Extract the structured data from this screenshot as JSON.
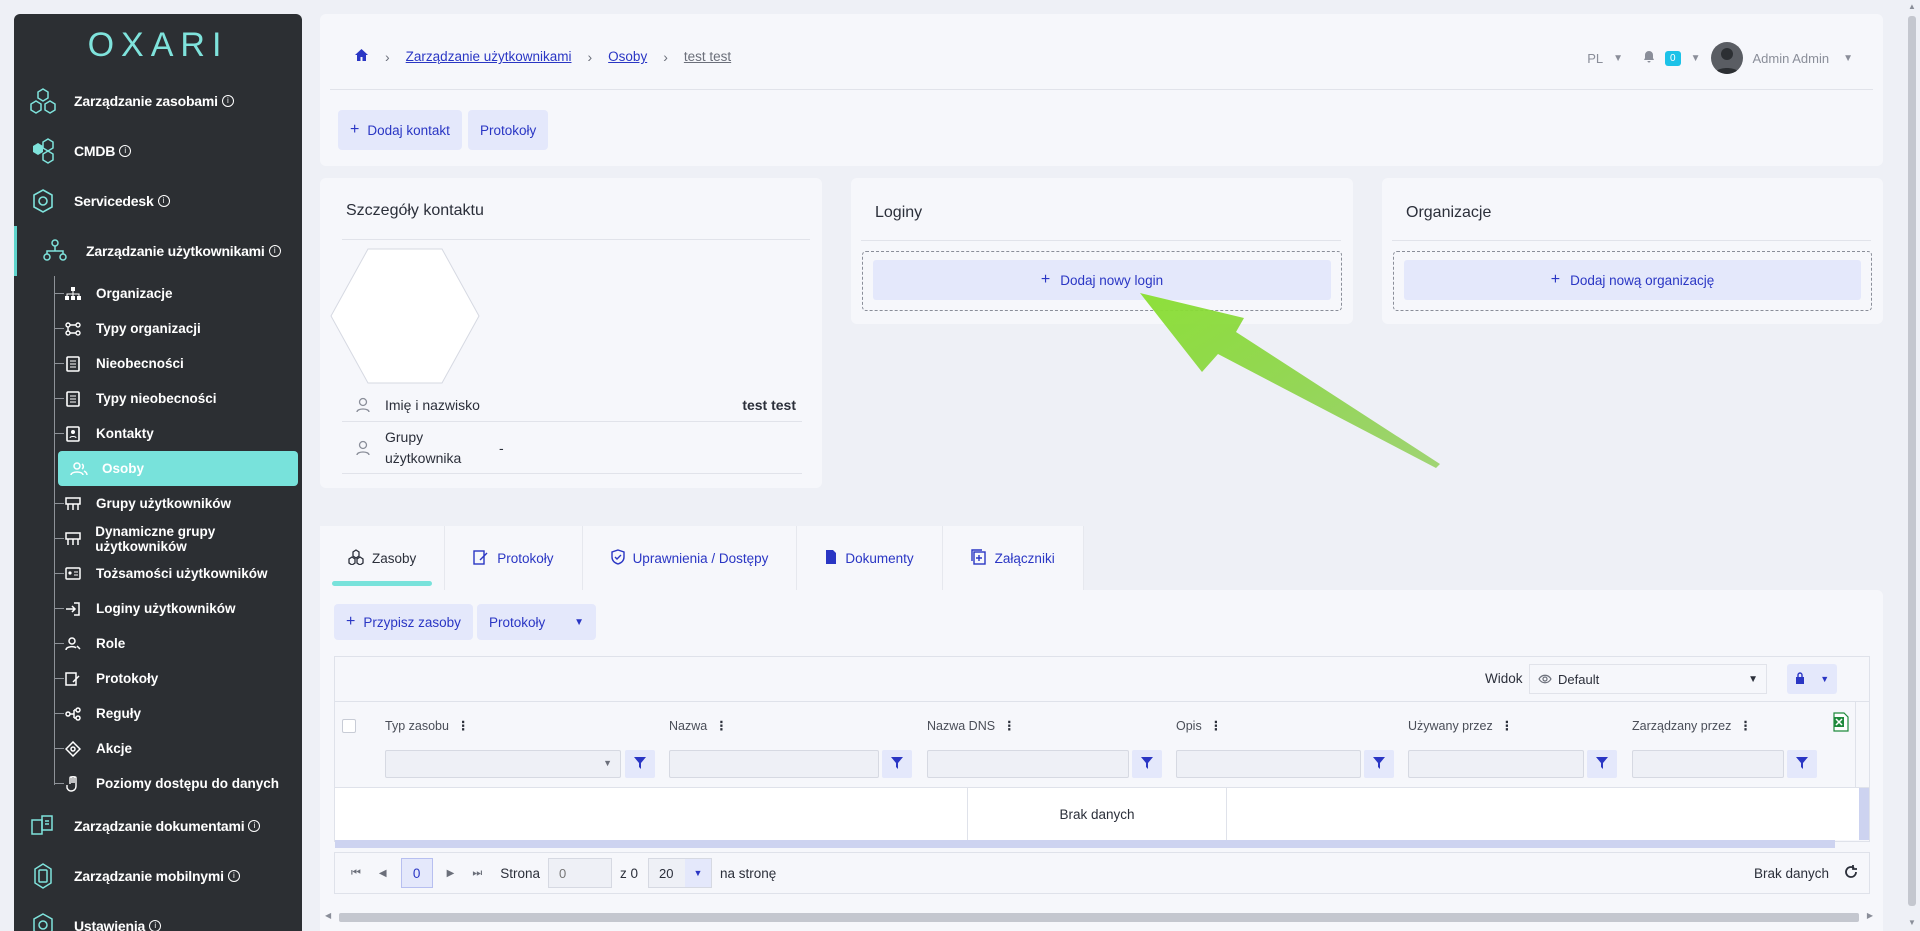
{
  "sidebar": {
    "logo": "OXARI",
    "main_items": [
      {
        "label": "Zarządzanie zasobami"
      },
      {
        "label": "CMDB"
      },
      {
        "label": "Servicedesk"
      },
      {
        "label": "Zarządzanie użytkownikami"
      }
    ],
    "sub_items": [
      {
        "label": "Organizacje"
      },
      {
        "label": "Typy organizacji"
      },
      {
        "label": "Nieobecności"
      },
      {
        "label": "Typy nieobecności"
      },
      {
        "label": "Kontakty"
      },
      {
        "label": "Osoby"
      },
      {
        "label": "Grupy użytkowników"
      },
      {
        "label": "Dynamiczne grupy użytkowników"
      },
      {
        "label": "Tożsamości użytkowników"
      },
      {
        "label": "Loginy użytkowników"
      },
      {
        "label": "Role"
      },
      {
        "label": "Protokoły"
      },
      {
        "label": "Reguły"
      },
      {
        "label": "Akcje"
      },
      {
        "label": "Poziomy dostępu do danych"
      }
    ],
    "bottom_items": [
      {
        "label": "Zarządzanie dokumentami"
      },
      {
        "label": "Zarządzanie mobilnymi"
      },
      {
        "label": "Ustawienia"
      }
    ],
    "accent_color": "#78e2db"
  },
  "header": {
    "breadcrumb": [
      "Zarządzanie użytkownikami",
      "Osoby",
      "test test"
    ],
    "language": "PL",
    "notifications": "0",
    "user": "Admin Admin",
    "buttons": {
      "add_contact": "Dodaj kontakt",
      "protocols": "Protokoły"
    }
  },
  "contact_details": {
    "title": "Szczegóły kontaktu",
    "name_label": "Imię i nazwisko",
    "name_value": "test test",
    "groups_label_1": "Grupy",
    "groups_label_2": "użytkownika",
    "groups_value": "-"
  },
  "logins": {
    "title": "Loginy",
    "add_button": "Dodaj nowy login"
  },
  "organizations": {
    "title": "Organizacje",
    "add_button": "Dodaj nową organizację"
  },
  "tabs": [
    "Zasoby",
    "Protokoły",
    "Uprawnienia / Dostępy",
    "Dokumenty",
    "Załączniki"
  ],
  "resources": {
    "assign_button": "Przypisz zasoby",
    "protocols_dropdown": "Protokoły",
    "view_label": "Widok",
    "view_value": "Default",
    "columns": [
      "Typ zasobu",
      "Nazwa",
      "Nazwa DNS",
      "Opis",
      "Używany przez",
      "Zarządzany przez"
    ],
    "empty_text": "Brak danych"
  },
  "pager": {
    "current_page": "0",
    "page_label": "Strona",
    "page_input_placeholder": "0",
    "of_label": "z 0",
    "page_size": "20",
    "per_page_label": "na stronę",
    "status": "Brak danych"
  }
}
